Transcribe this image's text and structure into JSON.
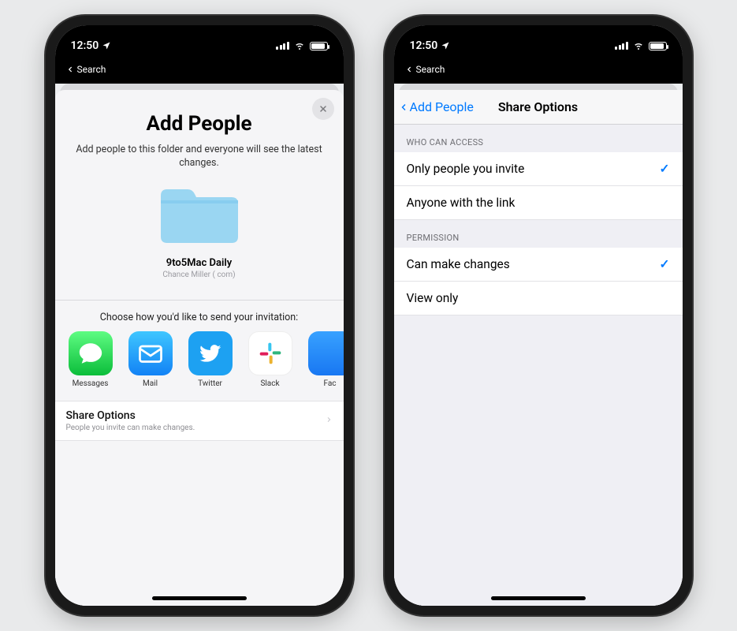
{
  "statusbar": {
    "time": "12:50",
    "search_back": "Search"
  },
  "screen1": {
    "title": "Add People",
    "subtitle": "Add people to this folder and everyone will see the latest changes.",
    "folder_name": "9to5Mac Daily",
    "folder_owner": "Chance Miller (                      com)",
    "choose_label": "Choose how you'd like to send your invitation:",
    "apps": [
      {
        "name": "Messages"
      },
      {
        "name": "Mail"
      },
      {
        "name": "Twitter"
      },
      {
        "name": "Slack"
      },
      {
        "name": "Fac"
      }
    ],
    "share_options_title": "Share Options",
    "share_options_sub": "People you invite can make changes."
  },
  "screen2": {
    "back_label": "Add People",
    "title": "Share Options",
    "groups": [
      {
        "header": "WHO CAN ACCESS",
        "rows": [
          {
            "label": "Only people you invite",
            "selected": true
          },
          {
            "label": "Anyone with the link",
            "selected": false
          }
        ]
      },
      {
        "header": "PERMISSION",
        "rows": [
          {
            "label": "Can make changes",
            "selected": true
          },
          {
            "label": "View only",
            "selected": false
          }
        ]
      }
    ]
  }
}
